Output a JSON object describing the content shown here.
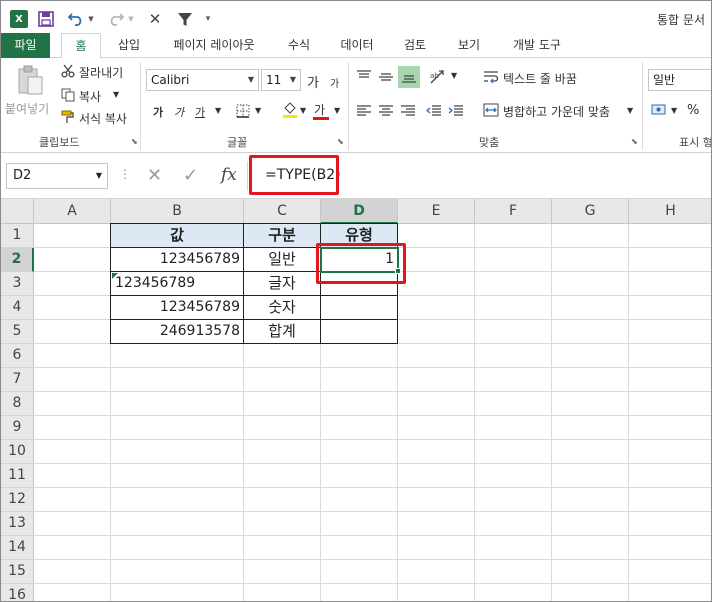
{
  "title": {
    "app_icon": "X",
    "quick_access": [
      "save-icon",
      "undo-icon",
      "redo-icon",
      "close-icon",
      "filter-icon"
    ],
    "doc_title": "통합 문서"
  },
  "tabs": [
    "파일",
    "홈",
    "삽입",
    "페이지 레이아웃",
    "수식",
    "데이터",
    "검토",
    "보기",
    "개발 도구"
  ],
  "ribbon": {
    "clipboard": {
      "paste_label": "붙여넣기",
      "cut_label": "잘라내기",
      "copy_label": "복사",
      "format_painter_label": "서식 복사",
      "group_label": "클립보드"
    },
    "font": {
      "font_name": "Calibri",
      "font_size": "11",
      "increase_size": "가",
      "decrease_size": "가",
      "bold": "가",
      "italic": "가",
      "underline": "가",
      "font_color_glyph": "가",
      "group_label": "글꼴"
    },
    "alignment": {
      "wrap_text_label": "텍스트 줄 바꿈",
      "merge_label": "병합하고 가운데 맞춤",
      "group_label": "맞춤"
    },
    "number": {
      "format": "일반",
      "percent": "%",
      "group_label": "표시 형"
    }
  },
  "formula_bar": {
    "name_box": "D2",
    "fx_label": "fx",
    "formula": "=TYPE(B2)"
  },
  "columns": [
    "A",
    "B",
    "C",
    "D",
    "E",
    "F",
    "G",
    "H"
  ],
  "rows": [
    "1",
    "2",
    "3",
    "4",
    "5",
    "6",
    "7",
    "8",
    "9",
    "10",
    "11",
    "12",
    "13",
    "14",
    "15",
    "16"
  ],
  "table": {
    "headers": [
      "값",
      "구분",
      "유형"
    ],
    "rows": [
      {
        "value": "123456789",
        "type_label": "일반",
        "result": "1"
      },
      {
        "value": "123456789",
        "type_label": "글자",
        "result": ""
      },
      {
        "value": "123456789",
        "type_label": "숫자",
        "result": ""
      },
      {
        "value": "246913578",
        "type_label": "합계",
        "result": ""
      }
    ]
  },
  "colors": {
    "excel_green": "#217346",
    "highlight_red": "#e0171f",
    "header_fill": "#dce9f5"
  }
}
